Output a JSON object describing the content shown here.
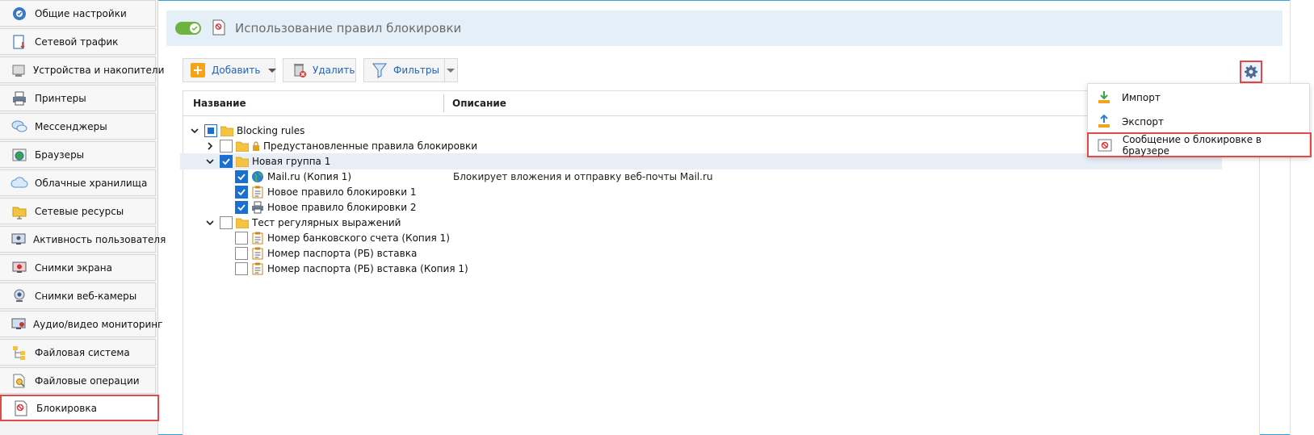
{
  "sidebar": {
    "items": [
      {
        "label": "Общие настройки",
        "icon": "settings-icon"
      },
      {
        "label": "Сетевой трафик",
        "icon": "network-traffic-icon"
      },
      {
        "label": "Устройства и накопители",
        "icon": "usb-device-icon"
      },
      {
        "label": "Принтеры",
        "icon": "printer-icon"
      },
      {
        "label": "Мессенджеры",
        "icon": "chat-bubbles-icon"
      },
      {
        "label": "Браузеры",
        "icon": "browser-globe-icon"
      },
      {
        "label": "Облачные хранилища",
        "icon": "cloud-icon"
      },
      {
        "label": "Сетевые ресурсы",
        "icon": "network-folder-icon"
      },
      {
        "label": "Активность пользователя",
        "icon": "user-activity-icon"
      },
      {
        "label": "Снимки экрана",
        "icon": "screenshot-icon"
      },
      {
        "label": "Снимки веб-камеры",
        "icon": "webcam-icon"
      },
      {
        "label": "Аудио/видео мониторинг",
        "icon": "av-monitor-icon"
      },
      {
        "label": "Файловая система",
        "icon": "file-tree-icon"
      },
      {
        "label": "Файловые операции",
        "icon": "file-search-icon"
      },
      {
        "label": "Блокировка",
        "icon": "block-document-icon"
      }
    ],
    "active_index": 14
  },
  "header": {
    "title": "Использование правил блокировки",
    "toggle_on": true
  },
  "toolbar": {
    "add_label": "Добавить",
    "delete_label": "Удалить",
    "filters_label": "Фильтры"
  },
  "grid": {
    "col_name": "Название",
    "col_desc": "Описание",
    "rows": [
      {
        "label": "Blocking rules",
        "desc": "",
        "level": 0,
        "chevron": "down",
        "check": "partial",
        "icon": "folder-icon"
      },
      {
        "label": "Предустановленные правила блокировки",
        "desc": "",
        "level": 1,
        "chevron": "right",
        "check": "none",
        "icon": "folder-icon",
        "lock": true
      },
      {
        "label": "Новая группа 1",
        "desc": "",
        "level": 1,
        "chevron": "down",
        "check": "checked",
        "icon": "folder-icon",
        "selected": true
      },
      {
        "label": "Mail.ru (Копия 1)",
        "desc": "Блокирует вложения и отправку веб-почты Mail.ru",
        "level": 2,
        "check": "checked",
        "icon": "globe-icon"
      },
      {
        "label": "Новое правило блокировки 1",
        "desc": "",
        "level": 2,
        "check": "checked",
        "icon": "clipboard-icon"
      },
      {
        "label": "Новое правило блокировки 2",
        "desc": "",
        "level": 2,
        "check": "checked",
        "icon": "printer-icon"
      },
      {
        "label": "Тест регулярных выражений",
        "desc": "",
        "level": 1,
        "chevron": "down",
        "check": "none",
        "icon": "folder-icon"
      },
      {
        "label": "Номер банковского счета (Копия 1)",
        "desc": "",
        "level": 2,
        "check": "none",
        "icon": "clipboard-icon"
      },
      {
        "label": "Номер паспорта (РБ) вставка",
        "desc": "",
        "level": 2,
        "check": "none",
        "icon": "clipboard-icon"
      },
      {
        "label": "Номер паспорта (РБ) вставка (Копия 1)",
        "desc": "",
        "level": 2,
        "check": "none",
        "icon": "clipboard-icon"
      }
    ]
  },
  "menu": {
    "items": [
      {
        "label": "Импорт",
        "icon": "import-icon"
      },
      {
        "label": "Экспорт",
        "icon": "export-icon"
      },
      {
        "label": "Сообщение о блокировке в браузере",
        "icon": "block-message-icon"
      }
    ],
    "highlight_index": 2
  },
  "colors": {
    "accent": "#2264b8",
    "highlight": "#e24a4a",
    "toggle": "#6cb33f",
    "header_bg": "#e4eff8",
    "checkbox": "#1a6fd1"
  }
}
